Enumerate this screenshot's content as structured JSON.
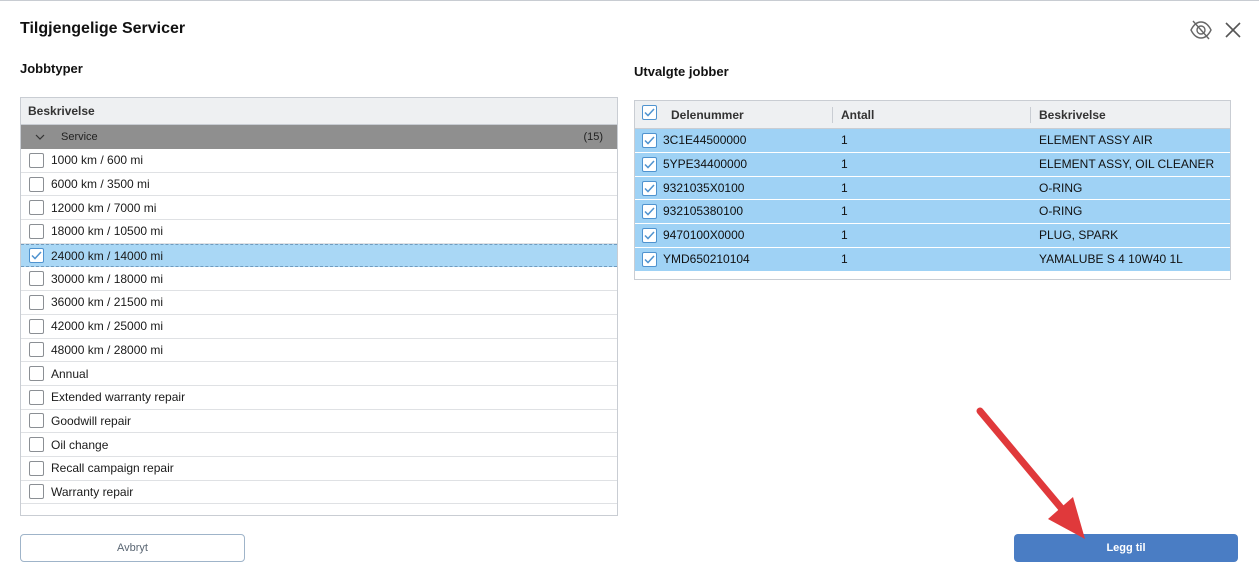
{
  "dialog": {
    "title": "Tilgjengelige Servicer"
  },
  "left": {
    "section_title": "Jobbtyper",
    "column_header": "Beskrivelse",
    "group": {
      "label": "Service",
      "count": "(15)"
    },
    "jobs": [
      {
        "label": "1000 km / 600 mi",
        "checked": false
      },
      {
        "label": "6000 km / 3500 mi",
        "checked": false
      },
      {
        "label": "12000 km / 7000 mi",
        "checked": false
      },
      {
        "label": "18000 km / 10500 mi",
        "checked": false
      },
      {
        "label": "24000 km / 14000 mi",
        "checked": true
      },
      {
        "label": "30000 km / 18000 mi",
        "checked": false
      },
      {
        "label": "36000 km / 21500 mi",
        "checked": false
      },
      {
        "label": "42000 km / 25000 mi",
        "checked": false
      },
      {
        "label": "48000 km / 28000 mi",
        "checked": false
      },
      {
        "label": "Annual",
        "checked": false
      },
      {
        "label": "Extended warranty repair",
        "checked": false
      },
      {
        "label": "Goodwill repair",
        "checked": false
      },
      {
        "label": "Oil change",
        "checked": false
      },
      {
        "label": "Recall campaign repair",
        "checked": false
      },
      {
        "label": "Warranty repair",
        "checked": false
      }
    ]
  },
  "right": {
    "section_title": "Utvalgte jobber",
    "columns": {
      "part_number": "Delenummer",
      "quantity": "Antall",
      "description": "Beskrivelse"
    },
    "parts": [
      {
        "part_number": "3C1E44500000",
        "quantity": "1",
        "description": "ELEMENT ASSY AIR"
      },
      {
        "part_number": "5YPE34400000",
        "quantity": "1",
        "description": "ELEMENT ASSY, OIL CLEANER"
      },
      {
        "part_number": "9321035X0100",
        "quantity": "1",
        "description": "O-RING"
      },
      {
        "part_number": "932105380100",
        "quantity": "1",
        "description": "O-RING"
      },
      {
        "part_number": "9470100X0000",
        "quantity": "1",
        "description": "PLUG, SPARK"
      },
      {
        "part_number": "YMD650210104",
        "quantity": "1",
        "description": "YAMALUBE S 4 10W40 1L"
      }
    ]
  },
  "buttons": {
    "cancel": "Avbryt",
    "add": "Legg til"
  },
  "icons": {
    "visibility": "eye-off-icon",
    "close": "close-icon",
    "annotation": "red-arrow-icon"
  },
  "colors": {
    "primary": "#4a7dc4",
    "selected_row": "#a9d7f5",
    "part_row": "#9fd2f5",
    "arrow": "#e0393b"
  }
}
